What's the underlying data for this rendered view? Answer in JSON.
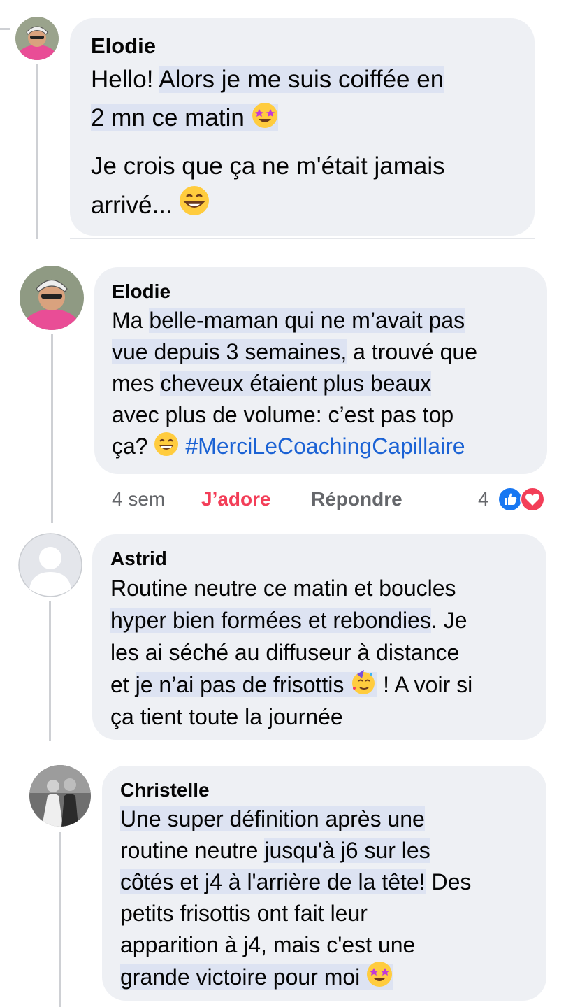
{
  "comments": [
    {
      "author": "Elodie",
      "text_a": "Hello! ",
      "text_b": "Alors je me suis coiffée en",
      "text_c": "2 mn ce matin ",
      "text_d": "Je crois que ça ne m'était jamais",
      "text_e": "arrivé... "
    },
    {
      "author": "Elodie",
      "line1_a": "Ma ",
      "line1_b": "belle-maman qui ne m’avait pas",
      "line2_a": "vue depuis 3 semaines,",
      "line2_b": " a trouvé que",
      "line3_a": "mes ",
      "line3_b": "cheveux étaient plus beaux",
      "line4": "avec plus de volume: c’est pas top",
      "line5_a": "ça? ",
      "hashtag": "#MerciLeCoachingCapillaire",
      "time": "4 sem",
      "like_label": "J’adore",
      "reply_label": "Répondre",
      "reaction_count": "4"
    },
    {
      "author": "Astrid",
      "line1": "Routine neutre ce matin et boucles",
      "line2_a": "hyper bien formées et rebondies",
      "line2_b": ". Je",
      "line3": "les ai séché au diffuseur à distance",
      "line4_a": "et ",
      "line4_b": "je n’ai pas de frisottis ",
      "line4_c": " ! A voir si",
      "line5": "ça tient toute la journée"
    },
    {
      "author": "Christelle",
      "line1": "Une super définition après une",
      "line2_a": "routine neutre ",
      "line2_b": "jusqu'à j6 sur les",
      "line3_a": "côtés et j4 à l'arrière de la tête!",
      "line3_b": " Des",
      "line4": "petits frisottis ont fait leur",
      "line5": "apparition à j4, mais c'est une",
      "line6": "grande victoire pour moi "
    }
  ],
  "colors": {
    "bubble": "#eef0f4",
    "highlight": "#dde3f2",
    "love": "#f33e58",
    "like": "#1877f2",
    "hashtag": "#1b62d4",
    "meta": "#65676b"
  },
  "icons": {
    "star_struck": "star-struck-emoji",
    "grin": "grinning-emoji",
    "smile": "smiling-emoji",
    "party": "partying-face-emoji",
    "like": "like-reaction-icon",
    "love": "love-reaction-icon"
  }
}
